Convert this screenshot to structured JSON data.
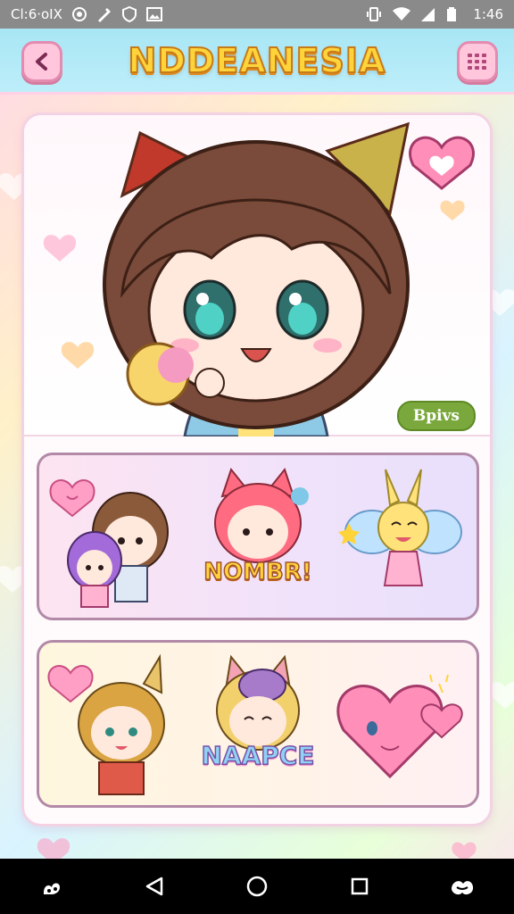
{
  "status_bar": {
    "left_text": "Cl:6·oIX",
    "time": "1:46",
    "icons": [
      "notification-icon",
      "tool-icon",
      "shield-icon",
      "image-icon",
      "vibrate-icon",
      "wifi-icon",
      "signal-icon",
      "battery-icon"
    ]
  },
  "header": {
    "title": "NDDEANESIA",
    "back_icon": "chevron-left-icon",
    "menu_icon": "grid-icon"
  },
  "hero": {
    "badge": "Bpivs"
  },
  "rows": [
    {
      "stickers": [
        "two-girls-sticker",
        "red-hair-cat-girl-sticker",
        "yellow-bunny-fairy-sticker"
      ],
      "text": "NOMBR!"
    },
    {
      "stickers": [
        "blonde-cat-boy-sticker",
        "blonde-cat-girl-sticker",
        "pink-heart-creature-sticker"
      ],
      "text": "NAAPCE"
    }
  ],
  "colors": {
    "header_bg": "#a8e6f4",
    "title": "#ffd43b",
    "accent_pink": "#ffc6dc",
    "badge": "#7aa83c"
  },
  "nav_bar": {
    "icons": [
      "apps-icon",
      "back-triangle-icon",
      "home-circle-icon",
      "recents-square-icon",
      "assistant-icon"
    ]
  }
}
